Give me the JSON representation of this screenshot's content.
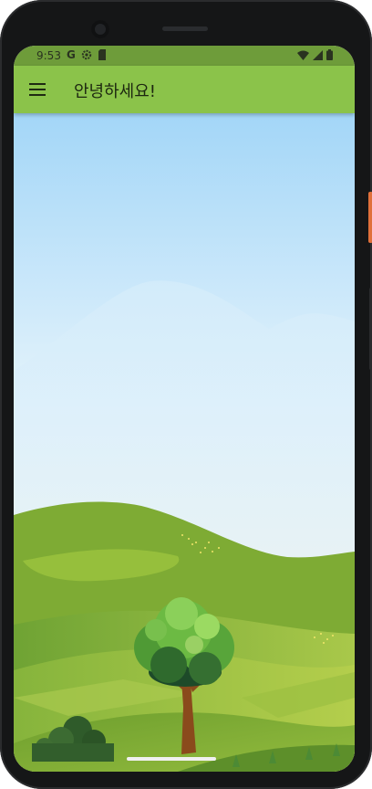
{
  "status_bar": {
    "time": "9:53",
    "left_icons": [
      "google-icon",
      "settings-icon",
      "sd-card-icon"
    ],
    "right_icons": [
      "wifi-icon",
      "signal-icon",
      "battery-icon"
    ]
  },
  "app_bar": {
    "title": "안녕하세요!",
    "menu_icon": "hamburger-menu-icon",
    "color": "#8bc34a"
  },
  "content": {
    "illustration": "landscape-with-tree"
  },
  "colors": {
    "status_bar": "#6e9c3a",
    "app_bar": "#8bc34a",
    "sky_top": "#a6d8f7",
    "sky_bottom": "#f3e8b4",
    "hills": "#7fae3a"
  }
}
